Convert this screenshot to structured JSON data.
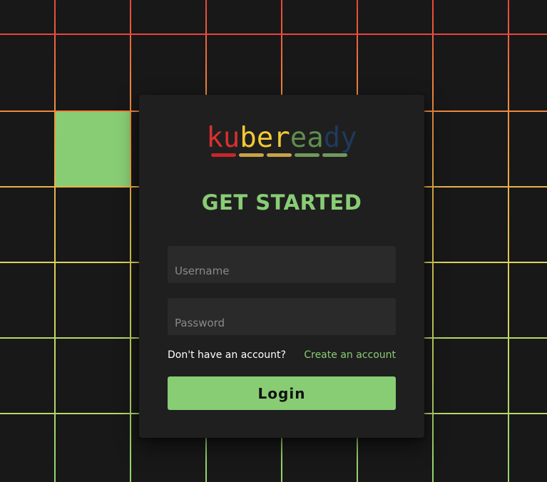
{
  "background": {
    "grid_colors": [
      "#e8453c",
      "#f0873e",
      "#e9b24a",
      "#d9d45a",
      "#b7d86a",
      "#8fd472"
    ],
    "highlight_color": "#88cd74"
  },
  "logo": {
    "letters": [
      "k",
      "u",
      "b",
      "e",
      "r",
      "e",
      "a",
      "d",
      "y"
    ],
    "letter_colors": [
      "#d8302f",
      "#d8302f",
      "#f2c933",
      "#f2c933",
      "#f2c933",
      "#5f8e4f",
      "#5f8e4f",
      "#1f3a5c",
      "#1f3a5c"
    ],
    "bar_colors": [
      "#c8262a",
      "#c9a24a",
      "#c9a24a",
      "#6f9a5e",
      "#6f9a5e"
    ]
  },
  "title": "GET STARTED",
  "form": {
    "username_placeholder": "Username",
    "password_placeholder": "Password",
    "account_question": "Don't have an account?",
    "create_account_link": "Create an account",
    "login_label": "Login"
  },
  "colors": {
    "accent": "#88cd74",
    "card": "#1f1f1f",
    "input": "#2a2a2a"
  }
}
